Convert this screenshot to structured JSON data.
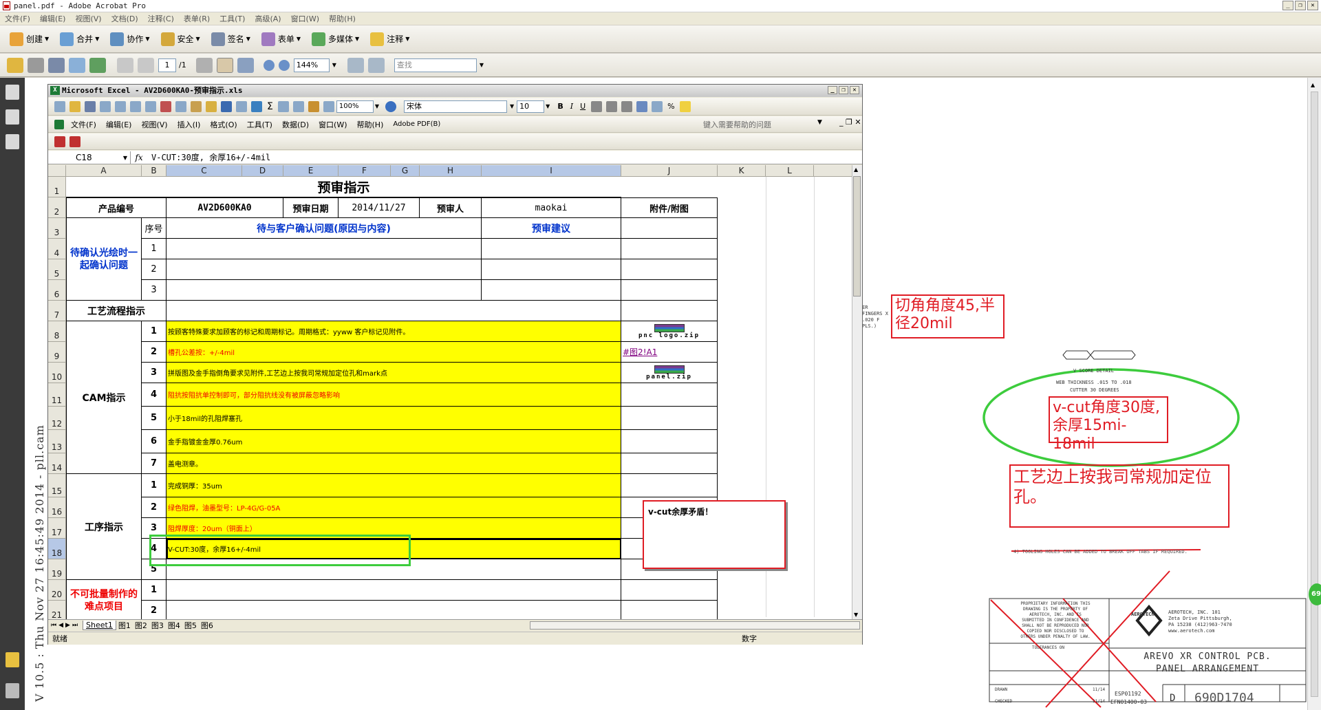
{
  "app": {
    "title": "panel.pdf - Adobe Acrobat Pro",
    "menu": [
      "文件(F)",
      "编辑(E)",
      "视图(V)",
      "文档(D)",
      "注释(C)",
      "表单(R)",
      "工具(T)",
      "高级(A)",
      "窗口(W)",
      "帮助(H)"
    ],
    "toolbar": [
      "创建",
      "合并",
      "协作",
      "安全",
      "签名",
      "表单",
      "多媒体",
      "注释"
    ],
    "page_current": "1",
    "page_total": "/1",
    "zoom": "144%",
    "search_placeholder": "查找",
    "vertical_stamp": "V 10.5 : Thu Nov 27 16:45:49 2014 - pll.cam"
  },
  "excel": {
    "title": "Microsoft Excel - AV2D600KA0-预审指示.xls",
    "menu": [
      "文件(F)",
      "编辑(E)",
      "视图(V)",
      "插入(I)",
      "格式(O)",
      "工具(T)",
      "数据(D)",
      "窗口(W)",
      "帮助(H)",
      "Adobe PDF(B)"
    ],
    "help_placeholder": "键入需要帮助的问题",
    "zoom": "100%",
    "font": "宋体",
    "size": "10",
    "name_box": "C18",
    "fx": "fx",
    "formula": "V-CUT:30度, 余厚16+/-4mil",
    "columns": [
      "A",
      "B",
      "C",
      "D",
      "E",
      "F",
      "G",
      "H",
      "I",
      "J",
      "K",
      "L"
    ],
    "rows": [
      "1",
      "2",
      "3",
      "4",
      "5",
      "6",
      "7",
      "8",
      "9",
      "10",
      "11",
      "12",
      "13",
      "14",
      "15",
      "16",
      "17",
      "18",
      "19",
      "20",
      "21"
    ],
    "cells": {
      "title": "预审指示",
      "product_label": "产品编号",
      "product_value": "AV2D600KA0",
      "date_label": "预审日期",
      "date_value": "2014/11/27",
      "reviewer_label": "预审人",
      "reviewer_value": "maokai",
      "attach_label": "附件/附图",
      "seq_label": "序号",
      "issue_header": "待与客户确认问题(原因与内容)",
      "advice_header": "预审建议",
      "confirm_label": "待确认光绘时一起确认问题",
      "n1": "1",
      "n2": "2",
      "n3": "3",
      "n4": "4",
      "n5": "5",
      "n6": "6",
      "n7": "7",
      "flow_label": "工艺流程指示",
      "cam_label": "CAM指示",
      "cam1": "按顾客特殊要求加顾客的标记和周期标记。周期格式：yyww 客户标记见附件。",
      "cam2": "槽孔公差按：+/-4mil",
      "cam3": "拼版图及金手指倒角要求见附件,工艺边上按我司常规加定位孔和mark点",
      "cam4": "阻抗按阻抗单控制即可，部分阻抗线没有被屏蔽忽略影响",
      "cam5": "小于18mil的孔阻焊塞孔",
      "cam6": "金手指镀金金厚0.76um",
      "cam7": "盖电测章。",
      "attach1": "pnc logo.zip",
      "attach2": "#图2!A1",
      "attach3": "panel.zip",
      "proc_label": "工序指示",
      "proc1": "完成铜厚：35um",
      "proc2": "绿色阻焊，油墨型号：LP-4G/G-05A",
      "proc3": "阻焊厚度：20um（铜面上）",
      "proc4": "V-CUT:30度，余厚16+/-4mil",
      "proc5": "5",
      "hard_label": "不可批量制作的难点项目",
      "h1": "1",
      "h2": "2",
      "comment": "v-cut余厚矛盾！"
    },
    "sheets": [
      "Sheet1",
      "图1",
      "图2",
      "图3",
      "图4",
      "图5",
      "图6"
    ],
    "status_left": "就绪",
    "status_right": "数字"
  },
  "drawing": {
    "anno1": "切角角度45,半径20mil",
    "anno2": "v-cut角度30度,余厚15mi-18mil",
    "anno3": "工艺边上按我司常规加定位孔。",
    "fingers_note": "ER FINGERS X .020 F PLS.)",
    "vscore_title": "V SCORE DETAIL",
    "web_thickness": "WEB THICKNESS .015 TO .018",
    "cutter": "CUTTER 30 DEGREES",
    "note4": "4) TOOLING HOLES CAN BE ADDED TO BREAK OFF TABS IF REQUIRED.",
    "proprietary": "PROPRIETARY INFORMATION THIS DRAWING IS THE PROPERTY OF AEROTECH, INC. AND IS SUBMITTED IN CONFIDENCE AND SHALL NOT BE REPRODUCED NOR COPIED NOR DISCLOSED TO OTHERS UNDER PENALTY OF LAW.",
    "company": "AEROTECH, INC. 101 Zeta Drive Pittsburgh, PA 15238 (412)963-7470 www.aerotech.com",
    "logo_text": "AEROTECH",
    "tolerances": "TOLERANCES ON",
    "dwg_title": "AREVO XR CONTROL PCB. PANEL ARRANGEMENT",
    "part_code": "ESP01192",
    "part_code2": "EFN01400-03",
    "size": "D",
    "dwg_no": "690D1704",
    "drawn": "DRAWN",
    "checked": "CHECKED",
    "date1": "11/14",
    "date2": "11/14",
    "badge": "69"
  },
  "colors": {
    "accent_red": "#e01c24",
    "accent_green": "#3dcc3d",
    "highlight_yellow": "#ffff00",
    "title_blue": "#0033cc"
  }
}
